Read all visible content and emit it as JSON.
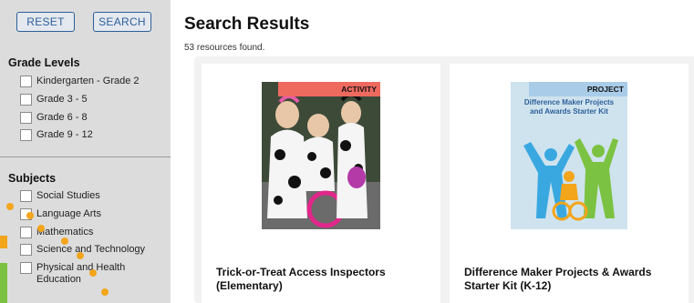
{
  "buttons": {
    "reset": "RESET",
    "search": "SEARCH"
  },
  "filters": {
    "grade_levels": {
      "title": "Grade Levels",
      "options": [
        "Kindergarten - Grade 2",
        "Grade 3 - 5",
        "Grade 6 - 8",
        "Grade 9 - 12"
      ]
    },
    "subjects": {
      "title": "Subjects",
      "options": [
        "Social Studies",
        "Language Arts",
        "Mathematics",
        "Science and Technology",
        "Physical and Health Education"
      ]
    }
  },
  "results": {
    "title": "Search Results",
    "count_text": "53 resources found.",
    "cards": [
      {
        "badge": "ACTIVITY",
        "title": "Trick-or-Treat Access Inspectors (Elementary)",
        "badge_color": "#ee6a5f"
      },
      {
        "badge": "PROJECT",
        "title": "Difference Maker Projects & Awards Starter Kit (K-12)",
        "badge_color": "#a9cce8",
        "thumb_title": "Difference Maker Projects and Awards Starter Kit"
      }
    ]
  },
  "colors": {
    "accent": "#2d5f9a",
    "sidebar_bg": "#dcdcdc",
    "dot": "#f3a51c"
  }
}
